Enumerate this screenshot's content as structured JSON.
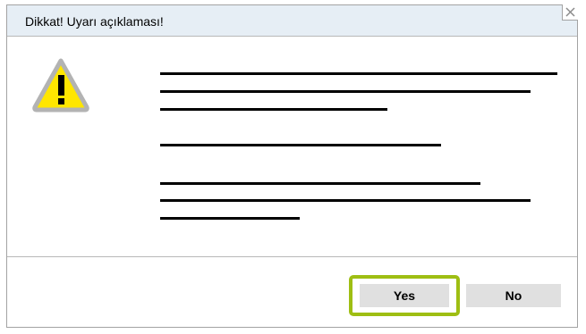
{
  "dialog": {
    "title": "Dikkat! Uyarı açıklaması!",
    "close_icon": "close-icon",
    "warning_icon": "warning-triangle-icon"
  },
  "buttons": {
    "yes_label": "Yes",
    "no_label": "No",
    "focused": "yes"
  },
  "colors": {
    "titlebar_bg": "#e6eef5",
    "focus_ring": "#9ebe13",
    "button_bg": "#e0e0e0",
    "warning_fill": "#ffe600",
    "warning_outline": "#b3b3b3"
  }
}
